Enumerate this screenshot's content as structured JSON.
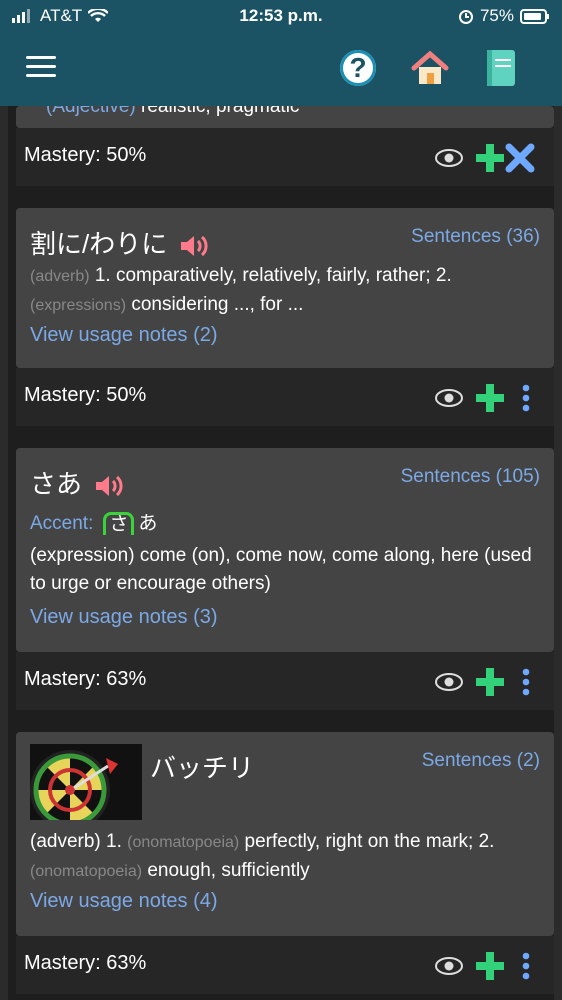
{
  "status_bar": {
    "carrier": "AT&T",
    "time": "12:53 p.m.",
    "battery": "75%"
  },
  "header": {
    "menu_icon": "hamburger-icon",
    "help_icon": "question-icon",
    "home_icon": "house-icon",
    "book_icon": "notebook-icon"
  },
  "partial_card": {
    "text_tag": "(Adjective)",
    "text": "realistic, pragmatic",
    "mastery": "Mastery: 50%"
  },
  "cards": [
    {
      "title": "割に/わりに",
      "sentences": "Sentences (36)",
      "def_tag1": "(adverb)",
      "def_text1": "1. comparatively, relatively, fairly, rather; 2.",
      "def_tag2": "(expressions)",
      "def_text2": "considering ..., for ...",
      "usage": "View usage notes (2)",
      "mastery": "Mastery: 50%"
    },
    {
      "title": "さあ",
      "sentences": "Sentences (105)",
      "accent_label": "Accent:",
      "accent_high": "さ",
      "accent_low": "あ",
      "def_tag1": "(expression)",
      "def_text1": "come (on), come now, come along, here (used to urge or encourage others)",
      "usage": "View usage notes (3)",
      "mastery": "Mastery: 63%"
    },
    {
      "title": "バッチリ",
      "sentences": "Sentences (2)",
      "def_tag1": "(adverb)",
      "def_text1a": "1.",
      "def_tag2": "(onomatopoeia)",
      "def_text2": "perfectly, right on the mark; 2.",
      "def_tag3": "(onomatopoeia)",
      "def_text3": "enough, sufficiently",
      "usage": "View usage notes (4)",
      "mastery": "Mastery: 63%"
    }
  ],
  "colors": {
    "header_bg": "#1c5364",
    "card_bg": "#444444",
    "link": "#7ca9e6",
    "plus_green": "#33d17a",
    "remove_blue": "#6ea8ff",
    "speaker_pink": "#ff7a8a",
    "accent_green": "#3ad43a"
  }
}
